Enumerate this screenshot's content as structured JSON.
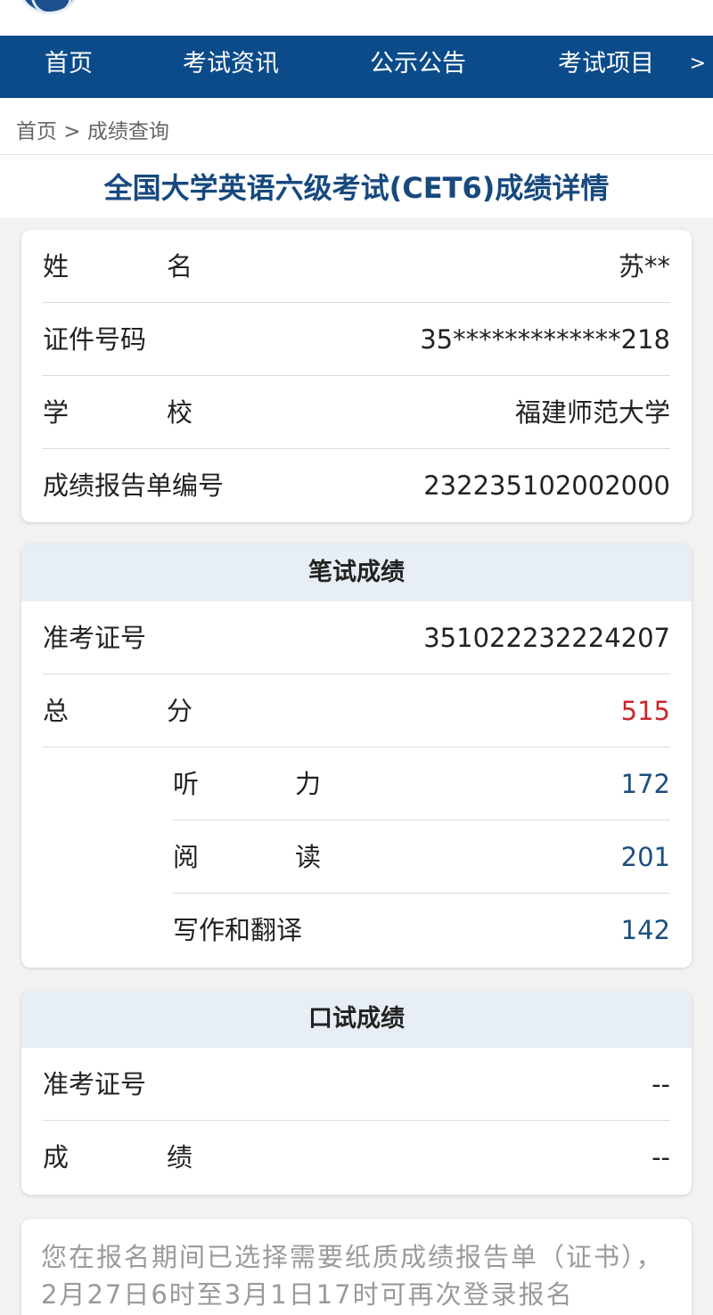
{
  "nav": {
    "items": [
      "首页",
      "考试资讯",
      "公示公告",
      "考试项目"
    ],
    "more_icon": "chevron-right"
  },
  "breadcrumb": "首页 > 成绩查询",
  "page_title": "全国大学英语六级考试(CET6)成绩详情",
  "personal_info": {
    "name_label": "姓名",
    "name_value": "苏**",
    "id_label": "证件号码",
    "id_value": "35*************218",
    "school_label": "学校",
    "school_value": "福建师范大学",
    "report_label": "成绩报告单编号",
    "report_value": "232235102002000"
  },
  "written": {
    "header": "笔试成绩",
    "ticket_label": "准考证号",
    "ticket_value": "351022232224207",
    "total_label": "总分",
    "total_value": "515",
    "listening_label": "听力",
    "listening_value": "172",
    "reading_label": "阅读",
    "reading_value": "201",
    "writing_label": "写作和翻译",
    "writing_value": "142"
  },
  "oral": {
    "header": "口试成绩",
    "ticket_label": "准考证号",
    "ticket_value": "--",
    "score_label": "成绩",
    "score_value": "--"
  },
  "notice": "您在报名期间已选择需要纸质成绩报告单（证书），2月27日6时至3月1日17时可再次登录报名",
  "colors": {
    "nav_bg": "#0b4b8a",
    "title": "#17497f",
    "total_score": "#c8262d",
    "sub_score": "#1c4f80"
  }
}
